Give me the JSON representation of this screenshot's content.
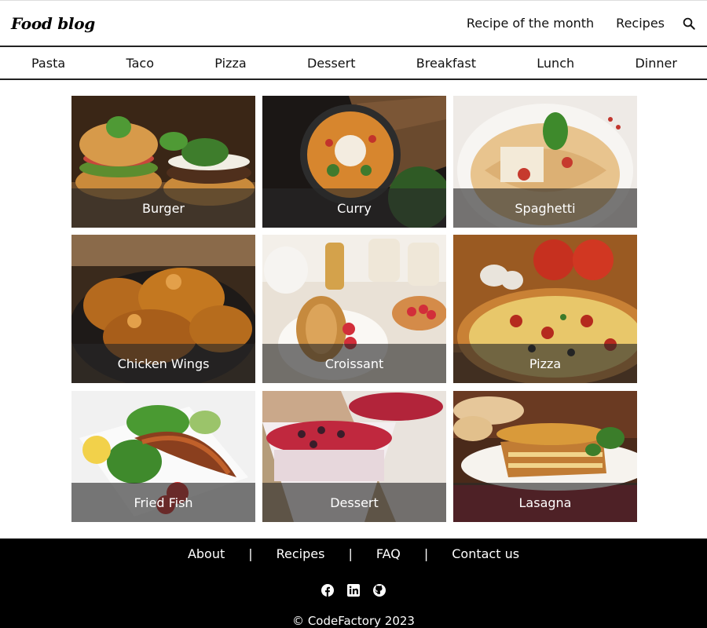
{
  "header": {
    "brand": "Food blog",
    "nav": [
      "Recipe of the month",
      "Recipes"
    ],
    "search_icon": "search-icon"
  },
  "categories": [
    "Pasta",
    "Taco",
    "Pizza",
    "Dessert",
    "Breakfast",
    "Lunch",
    "Dinner"
  ],
  "cards": [
    {
      "label": "Burger",
      "icon": "burger-image"
    },
    {
      "label": "Curry",
      "icon": "curry-image"
    },
    {
      "label": "Spaghetti",
      "icon": "spaghetti-image"
    },
    {
      "label": "Chicken Wings",
      "icon": "chicken-wings-image"
    },
    {
      "label": "Croissant",
      "icon": "croissant-image"
    },
    {
      "label": "Pizza",
      "icon": "pizza-image"
    },
    {
      "label": "Fried Fish",
      "icon": "fried-fish-image"
    },
    {
      "label": "Dessert",
      "icon": "dessert-image"
    },
    {
      "label": "Lasagna",
      "icon": "lasagna-image"
    }
  ],
  "footer": {
    "links": [
      "About",
      "Recipes",
      "FAQ",
      "Contact us"
    ],
    "separator": "|",
    "socials": [
      "facebook-icon",
      "linkedin-icon",
      "github-icon"
    ],
    "copyright": "© CodeFactory 2023"
  },
  "colors": {
    "caption_overlay": "#282828",
    "footer_bg": "#000000",
    "rule": "#222222"
  }
}
